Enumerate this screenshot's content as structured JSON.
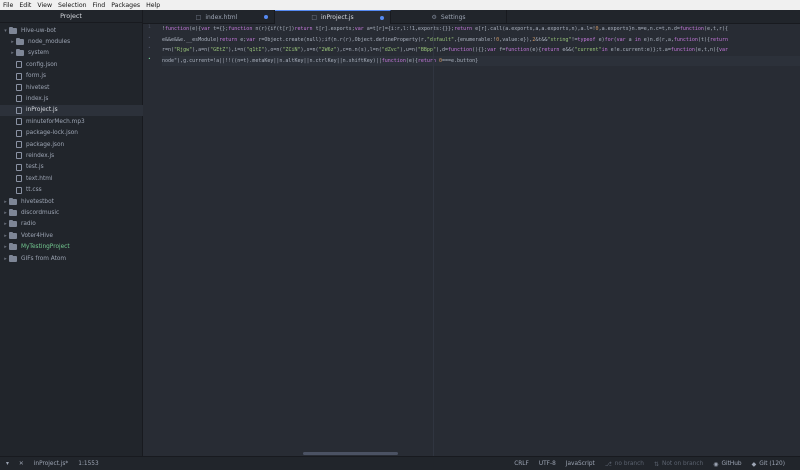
{
  "menu": [
    "File",
    "Edit",
    "View",
    "Selection",
    "Find",
    "Packages",
    "Help"
  ],
  "tree": {
    "title": "Project",
    "root": "Hive-uw-bot",
    "items": [
      {
        "label": "node_modules",
        "kind": "folder"
      },
      {
        "label": "system",
        "kind": "folder"
      },
      {
        "label": "config.json",
        "kind": "file"
      },
      {
        "label": "form.js",
        "kind": "file"
      },
      {
        "label": "hivetest",
        "kind": "file"
      },
      {
        "label": "index.js",
        "kind": "file"
      },
      {
        "label": "inProject.js",
        "kind": "file",
        "selected": true
      },
      {
        "label": "minuteforMech.mp3",
        "kind": "file"
      },
      {
        "label": "package-lock.json",
        "kind": "file"
      },
      {
        "label": "package.json",
        "kind": "file"
      },
      {
        "label": "reindex.js",
        "kind": "file"
      },
      {
        "label": "test.js",
        "kind": "file"
      },
      {
        "label": "text.html",
        "kind": "file"
      },
      {
        "label": "tt.css",
        "kind": "file"
      }
    ],
    "projects": [
      "hivetestbot",
      "discordmusic",
      "radio",
      "Voter4Hive",
      "MyTestingProject",
      "GIFs from Atom"
    ]
  },
  "tabs": [
    {
      "label": "index.html",
      "icon": "file-icon",
      "modified": true
    },
    {
      "label": "inProject.js",
      "icon": "file-icon",
      "modified": true,
      "active": true
    },
    {
      "label": "Settings",
      "icon": "gear-icon"
    }
  ],
  "editor": {
    "line_numbers": [
      "1",
      "•",
      "•",
      "•"
    ],
    "lines": [
      "!function(e){var t={};function n(r){if(t[r])return t[r].exports;var a=t[r]={i:r,l:!1,exports:{}};return e[r].call(a.exports,a,a.exports,n),a.l=!0,a.exports}n.m=e,n.c=t,n.d=function(e,t,r){",
      "e&&e&&e.__esModule)return e;var r=Object.create(null);if(n.r(r),Object.defineProperty(r,\"default\",{enumerable:!0,value:e}),2&t&&\"string\"!=typeof e)for(var a in e)n.d(r,a,function(t){return",
      "r=n(\"Rjgw\"),a=n(\"GEtZ\"),i=n(\"q1tI\"),o=n(\"ZCiN\"),s=n(\"2W6z\"),c=n.n(s),l=n(\"dZvc\"),u=n(\"BBpp\"),d=function(){};var f=function(e){return e&&(\"current\"in e!e.current:e)};t.a=function(e,t,n){var",
      "node\"),g.current=!a||!!((n=t).metaKey||n.altKey||n.ctrlKey||n.shiftKey)||function(e){return 0===e.button}"
    ]
  },
  "status": {
    "file": "inProject.js*",
    "cursor": "1:1553",
    "line_ending": "CRLF",
    "encoding": "UTF-8",
    "grammar": "JavaScript",
    "branch": "no branch",
    "remote": "Not on branch",
    "github": "GitHub",
    "git": "Git (120)"
  }
}
